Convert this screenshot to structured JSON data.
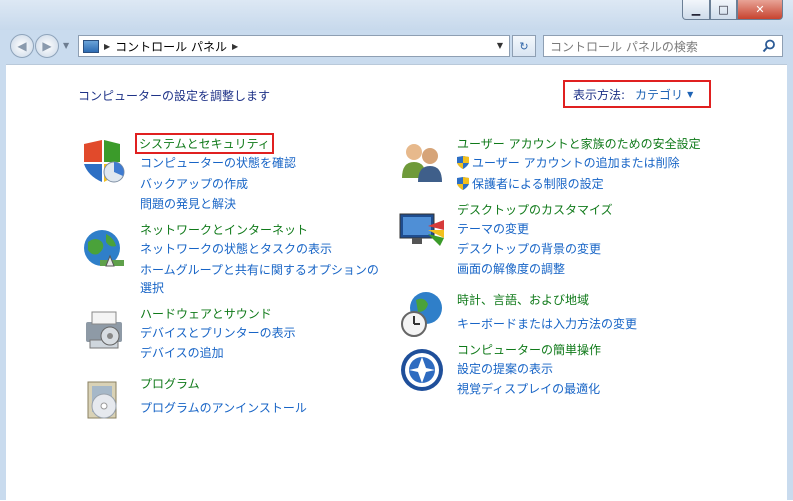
{
  "window": {
    "controls": {
      "minimize": "▁",
      "maximize": "□",
      "close": "✕"
    }
  },
  "address": {
    "path": "コントロール パネル",
    "sep1": "▶",
    "sep2": "▶",
    "dropdown": "▼"
  },
  "search": {
    "placeholder": "コントロール パネルの検索"
  },
  "page": {
    "heading": "コンピューターの設定を調整します",
    "view_by_label": "表示方法:",
    "view_by_value": "カテゴリ",
    "view_by_caret": "▼"
  },
  "categories": {
    "system_security": {
      "title": "システムとセキュリティ",
      "links": [
        "コンピューターの状態を確認",
        "バックアップの作成",
        "問題の発見と解決"
      ]
    },
    "network": {
      "title": "ネットワークとインターネット",
      "links": [
        "ネットワークの状態とタスクの表示",
        "ホームグループと共有に関するオプションの",
        "選択"
      ]
    },
    "hardware": {
      "title": "ハードウェアとサウンド",
      "links": [
        "デバイスとプリンターの表示",
        "デバイスの追加"
      ]
    },
    "programs": {
      "title": "プログラム",
      "links": [
        "プログラムのアンインストール"
      ]
    },
    "user_accounts": {
      "title": "ユーザー アカウントと家族のための安全設定",
      "links": [
        "ユーザー アカウントの追加または削除",
        "保護者による制限の設定"
      ]
    },
    "appearance": {
      "title": "デスクトップのカスタマイズ",
      "links": [
        "テーマの変更",
        "デスクトップの背景の変更",
        "画面の解像度の調整"
      ]
    },
    "clock": {
      "title": "時計、言語、および地域",
      "links": [
        "キーボードまたは入力方法の変更"
      ]
    },
    "ease": {
      "title": "コンピューターの簡単操作",
      "links": [
        "設定の提案の表示",
        "視覚ディスプレイの最適化"
      ]
    }
  },
  "colors": {
    "title_green": "#107a1a",
    "link_blue": "#1764c6",
    "highlight_red": "#e02020"
  }
}
